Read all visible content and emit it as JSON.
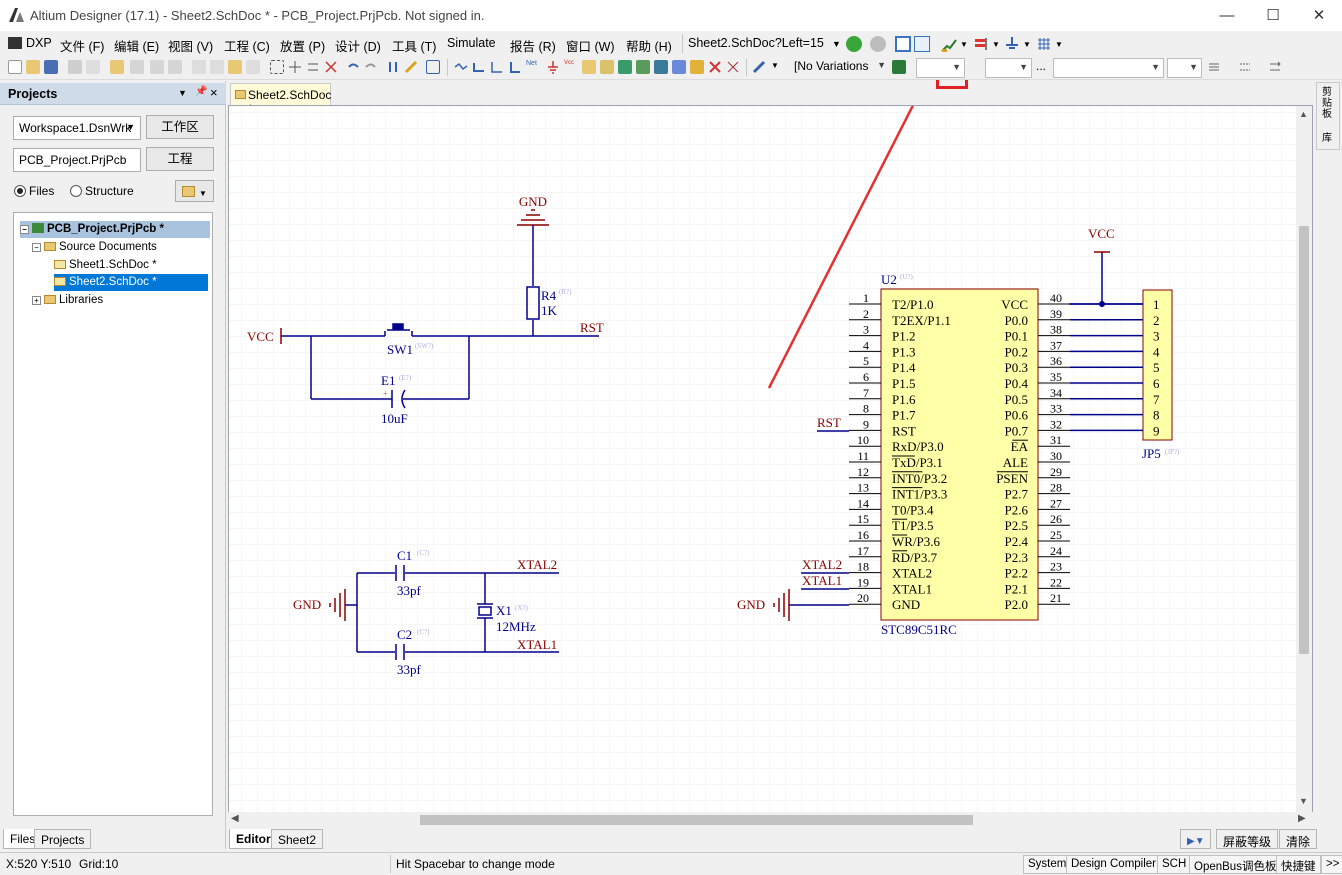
{
  "window": {
    "title": "Altium Designer (17.1) - Sheet2.SchDoc * - PCB_Project.PrjPcb. Not signed in."
  },
  "menu": {
    "items": [
      "DXP",
      "文件 (F)",
      "编辑 (E)",
      "视图 (V)",
      "工程 (C)",
      "放置 (P)",
      "设计 (D)",
      "工具 (T)",
      "Simulate",
      "报告 (R)",
      "窗口 (W)",
      "帮助 (H)"
    ],
    "address": "Sheet2.SchDoc?Left=15"
  },
  "toolbar": {
    "variations": "[No Variations"
  },
  "projects_panel": {
    "title": "Projects",
    "workspace": "Workspace1.DsnWrk",
    "workspace_button": "工作区",
    "project": "PCB_Project.PrjPcb",
    "project_button": "工程",
    "radio_files": "Files",
    "radio_structure": "Structure",
    "tree": {
      "project": "PCB_Project.PrjPcb *",
      "source_docs": "Source Documents",
      "sheet1": "Sheet1.SchDoc *",
      "sheet2": "Sheet2.SchDoc *",
      "libraries": "Libraries"
    },
    "tab_files": "Files",
    "tab_projects": "Projects"
  },
  "document_tab": "Sheet2.SchDoc *",
  "right_tabs": {
    "clipboard": "剪贴板",
    "library": "库"
  },
  "editor_tabs": {
    "editor": "Editor",
    "sheet2": "Sheet2"
  },
  "mask_controls": {
    "level": "屏蔽等级",
    "clear": "清除"
  },
  "status": {
    "coords": "X:520 Y:510",
    "grid": "Grid:10",
    "hint": "Hit Spacebar to change mode",
    "buttons": [
      "System",
      "Design Compiler",
      "SCH",
      "OpenBus调色板",
      "快捷键",
      ">>"
    ]
  },
  "schematic": {
    "gnd_label": "GND",
    "vcc_label": "VCC",
    "rst_label": "RST",
    "r4": {
      "ref": "R4",
      "value": "1K",
      "tag": "(R?)"
    },
    "sw1": {
      "ref": "SW1",
      "tag": "(SW?)"
    },
    "e1": {
      "ref": "E1",
      "value": "10uF",
      "tag": "(E?)"
    },
    "c1": {
      "ref": "C1",
      "value": "33pf",
      "tag": "(C?)"
    },
    "c2": {
      "ref": "C2",
      "value": "33pf",
      "tag": "(C?)"
    },
    "x1": {
      "ref": "X1",
      "value": "12MHz",
      "tag": "(X?)"
    },
    "xtal1": "XTAL1",
    "xtal2": "XTAL2",
    "u2": {
      "ref": "U2",
      "tag": "(U?)",
      "part": "STC89C51RC"
    },
    "jp5": {
      "ref": "JP5",
      "tag": "(JP?)"
    },
    "left_pins": [
      {
        "num": "1",
        "name": "T2/P1.0"
      },
      {
        "num": "2",
        "name": "T2EX/P1.1"
      },
      {
        "num": "3",
        "name": "P1.2"
      },
      {
        "num": "4",
        "name": "P1.3"
      },
      {
        "num": "5",
        "name": "P1.4"
      },
      {
        "num": "6",
        "name": "P1.5"
      },
      {
        "num": "7",
        "name": "P1.6"
      },
      {
        "num": "8",
        "name": "P1.7"
      },
      {
        "num": "9",
        "name": "RST"
      },
      {
        "num": "10",
        "name": "RxD/P3.0"
      },
      {
        "num": "11",
        "name": "TxD/P3.1"
      },
      {
        "num": "12",
        "name": "INT0/P3.2"
      },
      {
        "num": "13",
        "name": "INT1/P3.3"
      },
      {
        "num": "14",
        "name": "T0/P3.4"
      },
      {
        "num": "15",
        "name": "T1/P3.5"
      },
      {
        "num": "16",
        "name": "WR/P3.6"
      },
      {
        "num": "17",
        "name": "RD/P3.7"
      },
      {
        "num": "18",
        "name": "XTAL2"
      },
      {
        "num": "19",
        "name": "XTAL1"
      },
      {
        "num": "20",
        "name": "GND"
      }
    ],
    "right_pins": [
      {
        "num": "40",
        "name": "VCC"
      },
      {
        "num": "39",
        "name": "P0.0"
      },
      {
        "num": "38",
        "name": "P0.1"
      },
      {
        "num": "37",
        "name": "P0.2"
      },
      {
        "num": "36",
        "name": "P0.3"
      },
      {
        "num": "35",
        "name": "P0.4"
      },
      {
        "num": "34",
        "name": "P0.5"
      },
      {
        "num": "33",
        "name": "P0.6"
      },
      {
        "num": "32",
        "name": "P0.7"
      },
      {
        "num": "31",
        "name": "EA"
      },
      {
        "num": "30",
        "name": "ALE"
      },
      {
        "num": "29",
        "name": "PSEN"
      },
      {
        "num": "28",
        "name": "P2.7"
      },
      {
        "num": "27",
        "name": "P2.6"
      },
      {
        "num": "26",
        "name": "P2.5"
      },
      {
        "num": "25",
        "name": "P2.4"
      },
      {
        "num": "24",
        "name": "P2.3"
      },
      {
        "num": "23",
        "name": "P2.2"
      },
      {
        "num": "22",
        "name": "P2.1"
      },
      {
        "num": "21",
        "name": "P2.0"
      }
    ],
    "header_pins": [
      "1",
      "2",
      "3",
      "4",
      "5",
      "6",
      "7",
      "8",
      "9"
    ]
  },
  "colors": {
    "wire": "#00008b",
    "label": "#8b0000",
    "component_fill": "#ffffa8",
    "highlight": "#e02020"
  }
}
